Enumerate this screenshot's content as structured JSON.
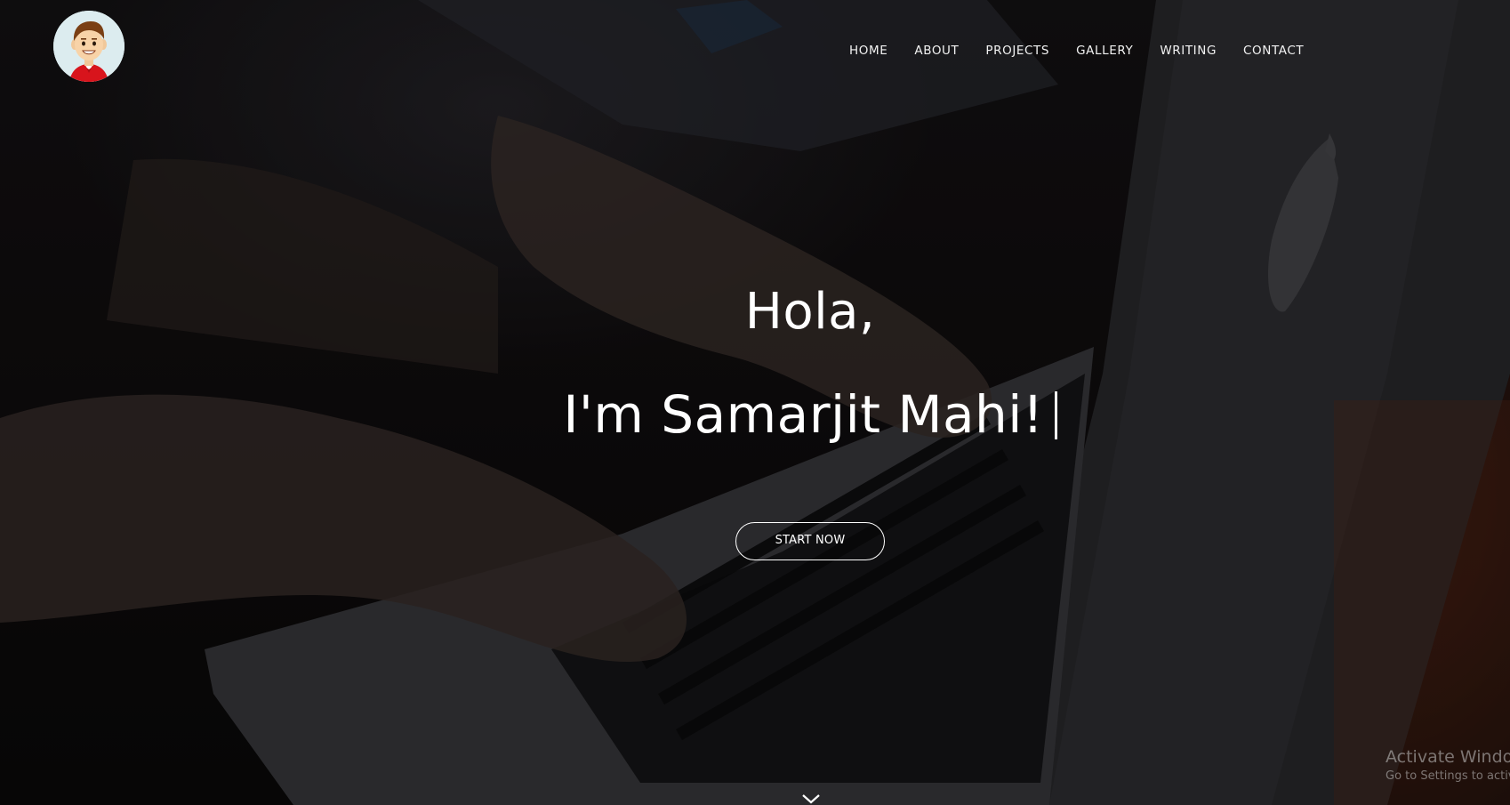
{
  "nav": {
    "items": [
      {
        "label": "HOME"
      },
      {
        "label": "ABOUT"
      },
      {
        "label": "PROJECTS"
      },
      {
        "label": "GALLERY"
      },
      {
        "label": "WRITING"
      },
      {
        "label": "CONTACT"
      }
    ]
  },
  "hero": {
    "greeting": "Hola,",
    "name_line": "I'm Samarjit Mahi!",
    "cta_label": "START NOW"
  },
  "watermark": {
    "title": "Activate Windows",
    "subtitle": "Go to Settings to activate Windows."
  },
  "icons": {
    "logo": "cartoon-avatar-icon",
    "scroll": "chevron-down-icon"
  },
  "colors": {
    "background": "#0c0a0a",
    "text": "#ffffff",
    "logo_bg": "#dcecef",
    "avatar_shirt": "#d8141c",
    "avatar_hair": "#7a3f14"
  }
}
